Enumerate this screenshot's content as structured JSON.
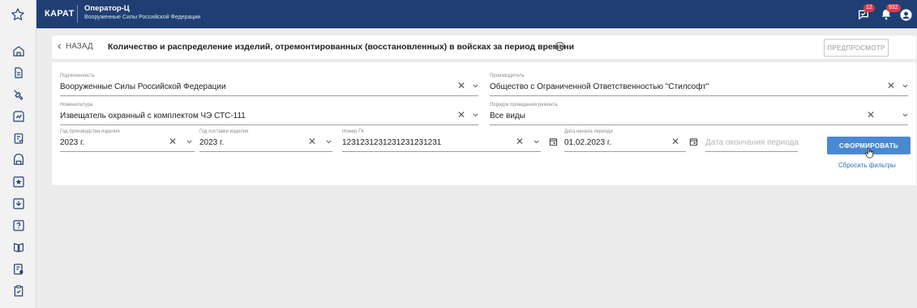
{
  "topbar": {
    "brand": "КАРАТ",
    "operator_title": "Оператор-Ц",
    "operator_subtitle": "Вооруженные Силы Российской Федерации",
    "messages_badge": "12",
    "notifications_badge": "932"
  },
  "sidebar": {
    "icons": [
      "home-icon",
      "document-icon",
      "wrench-icon",
      "chart-icon",
      "clipboard-icon",
      "stack-icon",
      "award-icon",
      "download-icon",
      "help-icon",
      "book-icon",
      "file-settings-icon",
      "checklist-icon"
    ]
  },
  "header": {
    "back_label": "НАЗАД",
    "title": "Количество и распределение изделий, отремонтированных (восстановленных) в войсках за период времени",
    "preview_label": "ПРЕДПРОСМОТР"
  },
  "filters": {
    "subordination": {
      "label": "Подчиненность",
      "value": "Вооруженные Силы Российской Федерации"
    },
    "manufacturer": {
      "label": "Производитель",
      "value": "Общество с Ограниченной Ответственностью \"Стилсофт\""
    },
    "nomenclature": {
      "label": "Номенклатура",
      "value": "Извещатель охранный с комплектом ЧЭ СТС-111"
    },
    "repair_order": {
      "label": "Порядок проведения ремонта",
      "value": "Все виды"
    },
    "production_year": {
      "label": "Год производства изделия",
      "value": "2023 г."
    },
    "delivery_year": {
      "label": "Год поставки изделия",
      "value": "2023 г."
    },
    "contract_number": {
      "label": "Номер ГК",
      "value": "1231231231231231231231"
    },
    "period_start": {
      "label": "Дата начала периода",
      "value": "01.02.2023 г."
    },
    "period_end": {
      "placeholder": "Дата окончания периода"
    }
  },
  "actions": {
    "generate_label": "СФОРМИРОВАТЬ",
    "reset_label": "Сбросить фильтры"
  },
  "colors": {
    "topbar": "#1f3f73",
    "accent": "#4a89cf",
    "badge": "#e0384a",
    "sidebar_bg": "#f2f2f2"
  }
}
